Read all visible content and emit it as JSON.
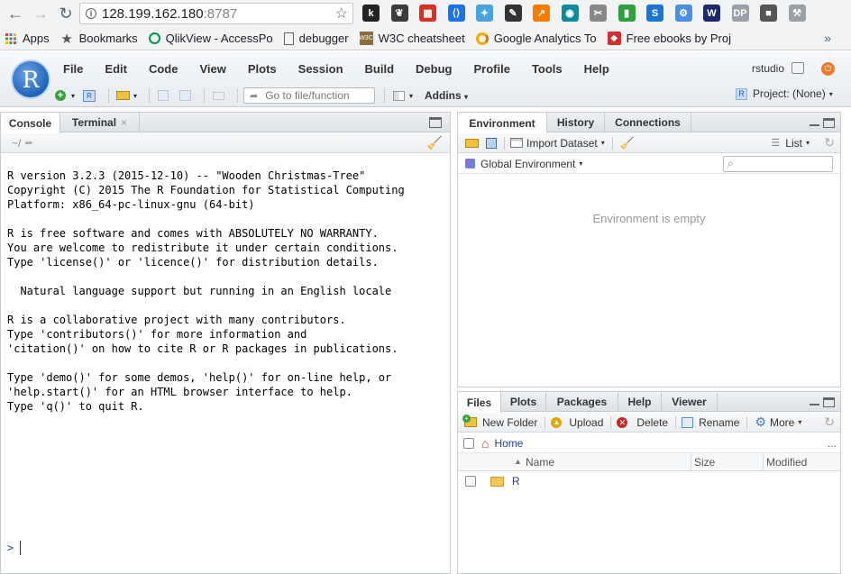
{
  "browser": {
    "url_host": "128.199.162.180",
    "url_port": ":8787",
    "extensions": [
      {
        "name": "k-icon",
        "label": "k",
        "color": "#222"
      },
      {
        "name": "evernote-icon",
        "label": "❦",
        "color": "#3b3b3b"
      },
      {
        "name": "grid-ext-icon",
        "label": "▦",
        "color": "#d93025"
      },
      {
        "name": "bracket-ext-icon",
        "label": "⟨⟩",
        "color": "#1a73e8"
      },
      {
        "name": "puzzle-ext-icon",
        "label": "✦",
        "color": "#4aa3df"
      },
      {
        "name": "dropper-ext-icon",
        "label": "✎",
        "color": "#333"
      },
      {
        "name": "chart-ext-icon",
        "label": "↗",
        "color": "#f57c00"
      },
      {
        "name": "eye-ext-icon",
        "label": "◉",
        "color": "#0a8c9c"
      },
      {
        "name": "screenshot-ext-icon",
        "label": "✂",
        "color": "#888"
      },
      {
        "name": "bars-ext-icon",
        "label": "▮",
        "color": "#2e9e3e"
      },
      {
        "name": "s-ext-icon",
        "label": "S",
        "color": "#1976d2"
      },
      {
        "name": "proxy-ext-icon",
        "label": "⚙",
        "color": "#4a90e2"
      },
      {
        "name": "w-ext-icon",
        "label": "W",
        "color": "#1a2a6b"
      },
      {
        "name": "dp-ext-icon",
        "label": "DP",
        "color": "#9aa0a6"
      },
      {
        "name": "square-ext-icon",
        "label": "■",
        "color": "#555"
      },
      {
        "name": "tools-ext-icon",
        "label": "⚒",
        "color": "#9aa0a6"
      }
    ],
    "bookmarks": [
      {
        "name": "bookmark-apps",
        "label": "Apps",
        "icon": "apps-grid-icon"
      },
      {
        "name": "bookmark-bookmarks",
        "label": "Bookmarks",
        "icon": "star-icon"
      },
      {
        "name": "bookmark-qlikview",
        "label": "QlikView - AccessPo",
        "icon": "qlik-icon"
      },
      {
        "name": "bookmark-debugger",
        "label": "debugger",
        "icon": "page-icon"
      },
      {
        "name": "bookmark-w3c",
        "label": "W3C cheatsheet",
        "icon": "w3c-icon"
      },
      {
        "name": "bookmark-google-analytics",
        "label": "Google Analytics To",
        "icon": "google-analytics-icon"
      },
      {
        "name": "bookmark-free-ebooks",
        "label": "Free ebooks by Proj",
        "icon": "ebook-icon"
      }
    ],
    "more_bookmarks": "»"
  },
  "rstudio": {
    "logo_letter": "R",
    "menu": [
      "File",
      "Edit",
      "Code",
      "View",
      "Plots",
      "Session",
      "Build",
      "Debug",
      "Profile",
      "Tools",
      "Help"
    ],
    "user": "rstudio",
    "goto_placeholder": "Go to file/function",
    "addins_label": "Addins",
    "project_label": "Project: (None)"
  },
  "console_pane": {
    "tabs": [
      "Console",
      "Terminal"
    ],
    "path": "~/",
    "output": "R version 3.2.3 (2015-12-10) -- \"Wooden Christmas-Tree\"\nCopyright (C) 2015 The R Foundation for Statistical Computing\nPlatform: x86_64-pc-linux-gnu (64-bit)\n\nR is free software and comes with ABSOLUTELY NO WARRANTY.\nYou are welcome to redistribute it under certain conditions.\nType 'license()' or 'licence()' for distribution details.\n\n  Natural language support but running in an English locale\n\nR is a collaborative project with many contributors.\nType 'contributors()' for more information and\n'citation()' on how to cite R or R packages in publications.\n\nType 'demo()' for some demos, 'help()' for on-line help, or\n'help.start()' for an HTML browser interface to help.\nType 'q()' to quit R.",
    "prompt": ">"
  },
  "env_pane": {
    "tabs": [
      "Environment",
      "History",
      "Connections"
    ],
    "import_label": "Import Dataset",
    "list_label": "List",
    "global_env_label": "Global Environment",
    "empty_message": "Environment is empty"
  },
  "files_pane": {
    "tabs": [
      "Files",
      "Plots",
      "Packages",
      "Help",
      "Viewer"
    ],
    "actions": {
      "new_folder": "New Folder",
      "upload": "Upload",
      "delete": "Delete",
      "rename": "Rename",
      "more": "More"
    },
    "breadcrumb_home": "Home",
    "more_dots": "...",
    "columns": {
      "name": "Name",
      "size": "Size",
      "modified": "Modified"
    },
    "rows": [
      {
        "name": "R"
      }
    ]
  }
}
